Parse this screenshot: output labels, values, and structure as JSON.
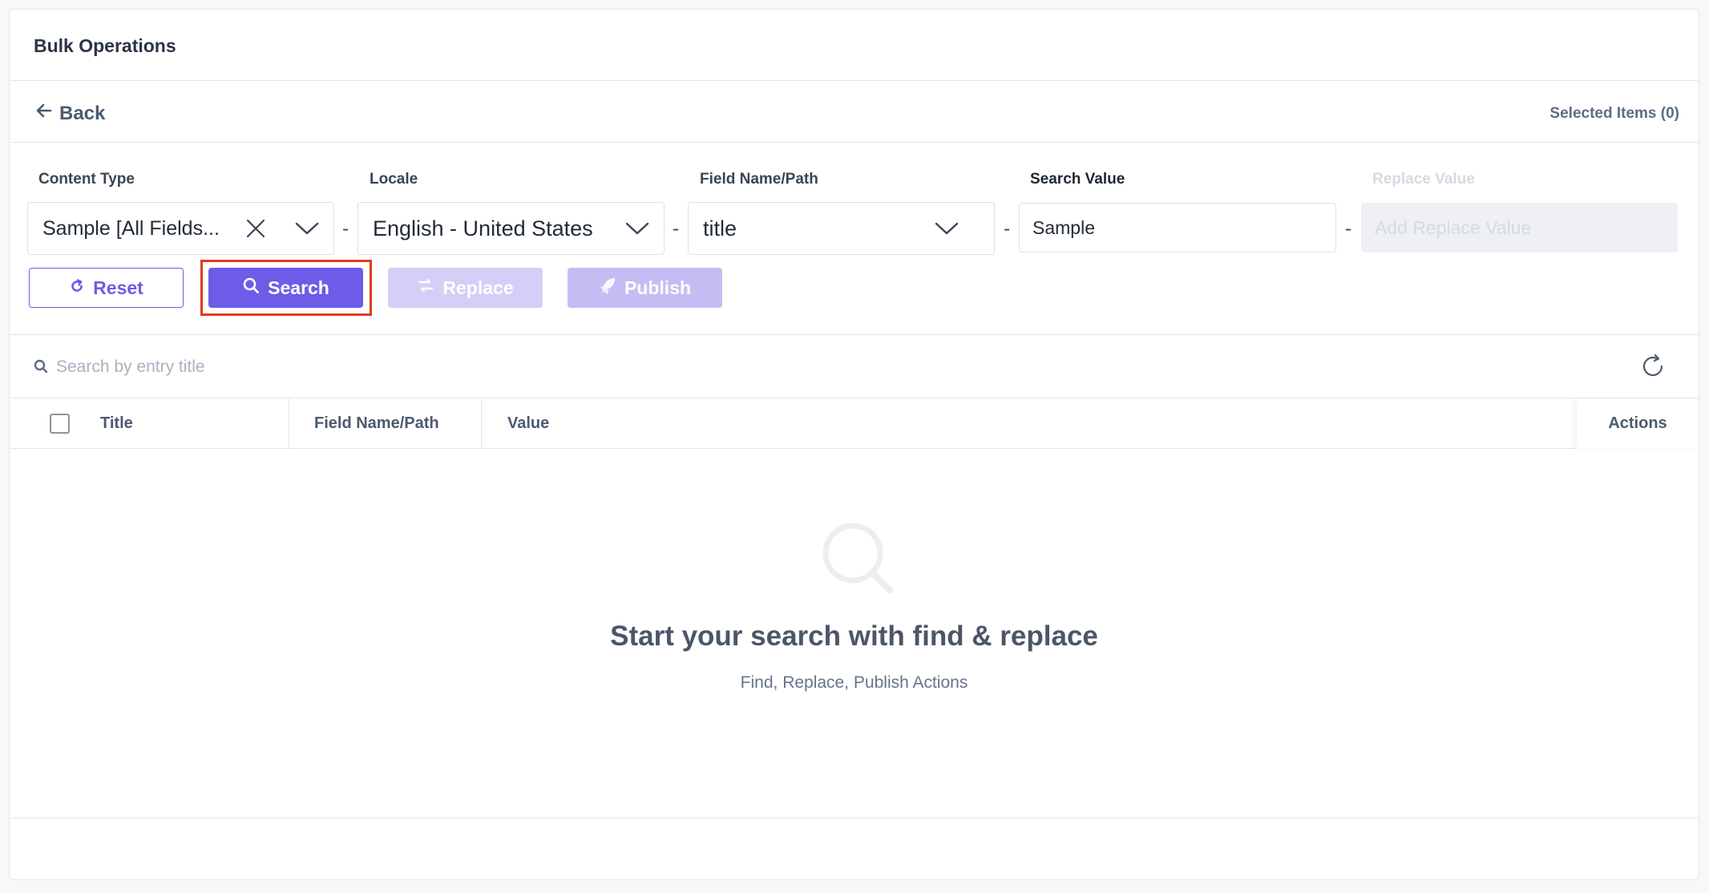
{
  "header": {
    "title": "Bulk Operations"
  },
  "nav": {
    "back_label": "Back",
    "selected_items": "Selected Items (0)"
  },
  "filters": {
    "content_type": {
      "label": "Content Type",
      "value": "Sample [All Fields..."
    },
    "locale": {
      "label": "Locale",
      "value": "English - United States"
    },
    "field_name": {
      "label": "Field Name/Path",
      "value": "title"
    },
    "search_value": {
      "label": "Search Value",
      "value": "Sample"
    },
    "replace_value": {
      "label": "Replace Value",
      "placeholder": "Add Replace Value"
    },
    "separator": "-"
  },
  "buttons": {
    "reset": "Reset",
    "search": "Search",
    "replace": "Replace",
    "publish": "Publish"
  },
  "table": {
    "search_placeholder": "Search by entry title",
    "columns": {
      "title": "Title",
      "field": "Field Name/Path",
      "value": "Value",
      "actions": "Actions"
    }
  },
  "empty_state": {
    "title": "Start your search with find & replace",
    "subtitle": "Find, Replace, Publish Actions"
  },
  "colors": {
    "accent": "#6c5ce7",
    "highlight": "#e23b21"
  }
}
